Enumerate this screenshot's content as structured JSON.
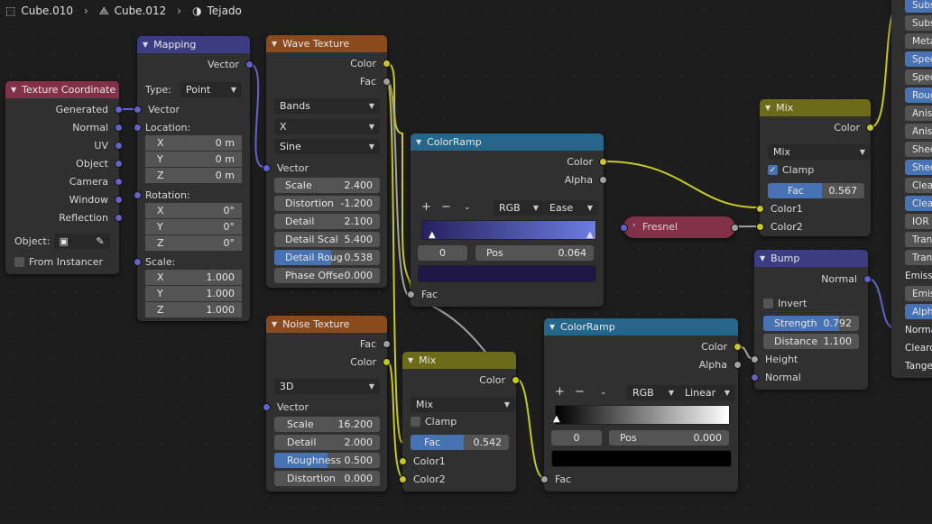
{
  "breadcrumb": {
    "item1": "Cube.010",
    "item2": "Cube.012",
    "item3": "Tejado"
  },
  "texcoord": {
    "title": "Texture Coordinate",
    "outputs": [
      "Generated",
      "Normal",
      "UV",
      "Object",
      "Camera",
      "Window",
      "Reflection"
    ],
    "object_label": "Object:",
    "from_instancer": "From Instancer"
  },
  "mapping": {
    "title": "Mapping",
    "out_vector": "Vector",
    "type_label": "Type:",
    "type_value": "Point",
    "in_vector": "Vector",
    "location_label": "Location:",
    "rotation_label": "Rotation:",
    "scale_label": "Scale:",
    "location": [
      {
        "axis": "X",
        "value": "0 m"
      },
      {
        "axis": "Y",
        "value": "0 m"
      },
      {
        "axis": "Z",
        "value": "0 m"
      }
    ],
    "rotation": [
      {
        "axis": "X",
        "value": "0°"
      },
      {
        "axis": "Y",
        "value": "0°"
      },
      {
        "axis": "Z",
        "value": "0°"
      }
    ],
    "scale": [
      {
        "axis": "X",
        "value": "1.000"
      },
      {
        "axis": "Y",
        "value": "1.000"
      },
      {
        "axis": "Z",
        "value": "1.000"
      }
    ]
  },
  "wave": {
    "title": "Wave Texture",
    "out_color": "Color",
    "out_fac": "Fac",
    "type": "Bands",
    "direction": "X",
    "profile": "Sine",
    "in_vector": "Vector",
    "params": [
      {
        "label": "Scale",
        "value": "2.400"
      },
      {
        "label": "Distortion",
        "value": "-1.200"
      },
      {
        "label": "Detail",
        "value": "2.100"
      },
      {
        "label": "Detail Scal",
        "value": "5.400"
      },
      {
        "label": "Detail Roug",
        "value": "0.538",
        "fill": 0.538
      },
      {
        "label": "Phase Offse",
        "value": "0.000"
      }
    ]
  },
  "noise": {
    "title": "Noise Texture",
    "out_fac": "Fac",
    "out_color": "Color",
    "dimensions": "3D",
    "in_vector": "Vector",
    "params": [
      {
        "label": "Scale",
        "value": "16.200"
      },
      {
        "label": "Detail",
        "value": "2.000"
      },
      {
        "label": "Roughness",
        "value": "0.500",
        "fill": 0.5
      },
      {
        "label": "Distortion",
        "value": "0.000"
      }
    ]
  },
  "ramp1": {
    "title": "ColorRamp",
    "out_color": "Color",
    "out_alpha": "Alpha",
    "plus": "+",
    "minus": "−",
    "mode": "RGB",
    "interp": "Ease",
    "stop_index": "0",
    "pos_label": "Pos",
    "pos_value": "0.064",
    "in_fac": "Fac",
    "grad_start": "#26215f",
    "grad_end": "#6b7ee2",
    "swatch": "#1e1646"
  },
  "ramp2": {
    "title": "ColorRamp",
    "out_color": "Color",
    "out_alpha": "Alpha",
    "plus": "+",
    "minus": "−",
    "mode": "RGB",
    "interp": "Linear",
    "stop_index": "0",
    "pos_label": "Pos",
    "pos_value": "0.000",
    "in_fac": "Fac",
    "grad_start": "#000000",
    "grad_end": "#ffffff",
    "swatch": "#000000"
  },
  "fresnel": {
    "title": "Fresnel"
  },
  "mix1": {
    "title": "Mix",
    "out_color": "Color",
    "blend": "Mix",
    "clamp": "Clamp",
    "clamp_on": true,
    "fac_label": "Fac",
    "fac_value": "0.567",
    "fac_fill": 0.567,
    "in1": "Color1",
    "in2": "Color2"
  },
  "mix2": {
    "title": "Mix",
    "out_color": "Color",
    "blend": "Mix",
    "clamp": "Clamp",
    "clamp_on": false,
    "fac_label": "Fac",
    "fac_value": "0.542",
    "fac_fill": 0.542,
    "in1": "Color1",
    "in2": "Color2"
  },
  "bump": {
    "title": "Bump",
    "out_normal": "Normal",
    "invert": "Invert",
    "strength_label": "Strength",
    "strength_value": "0.792",
    "strength_fill": 0.792,
    "distance_label": "Distance",
    "distance_value": "1.100",
    "in_height": "Height",
    "in_normal": "Normal"
  },
  "bsdf_items": [
    {
      "label": "Subs",
      "style": "on"
    },
    {
      "label": "Subs",
      "style": "gray"
    },
    {
      "label": "Meta",
      "style": "gray"
    },
    {
      "label": "Spec",
      "style": "on"
    },
    {
      "label": "Spec",
      "style": "gray"
    },
    {
      "label": "Roug",
      "style": "on"
    },
    {
      "label": "Anis",
      "style": "gray"
    },
    {
      "label": "Anis",
      "style": "gray"
    },
    {
      "label": "Shee",
      "style": "gray"
    },
    {
      "label": "Shee",
      "style": "on"
    },
    {
      "label": "Clea",
      "style": "gray"
    },
    {
      "label": "Clea",
      "style": "on"
    },
    {
      "label": "IOR",
      "style": "gray"
    },
    {
      "label": "Tran",
      "style": "gray"
    },
    {
      "label": "Tran",
      "style": "gray"
    },
    {
      "label": "Emissi",
      "style": "txt"
    },
    {
      "label": "Emis",
      "style": "gray"
    },
    {
      "label": "Alph",
      "style": "on"
    },
    {
      "label": "Norma",
      "style": "txt"
    },
    {
      "label": "Clearco",
      "style": "txt"
    },
    {
      "label": "Tangen",
      "style": "txt"
    }
  ],
  "colors": {
    "accent": "#4772b3",
    "vector_socket": "#6363c7",
    "color_socket": "#c7c729",
    "float_socket": "#a1a1a1",
    "shader_socket": "#63c763"
  }
}
